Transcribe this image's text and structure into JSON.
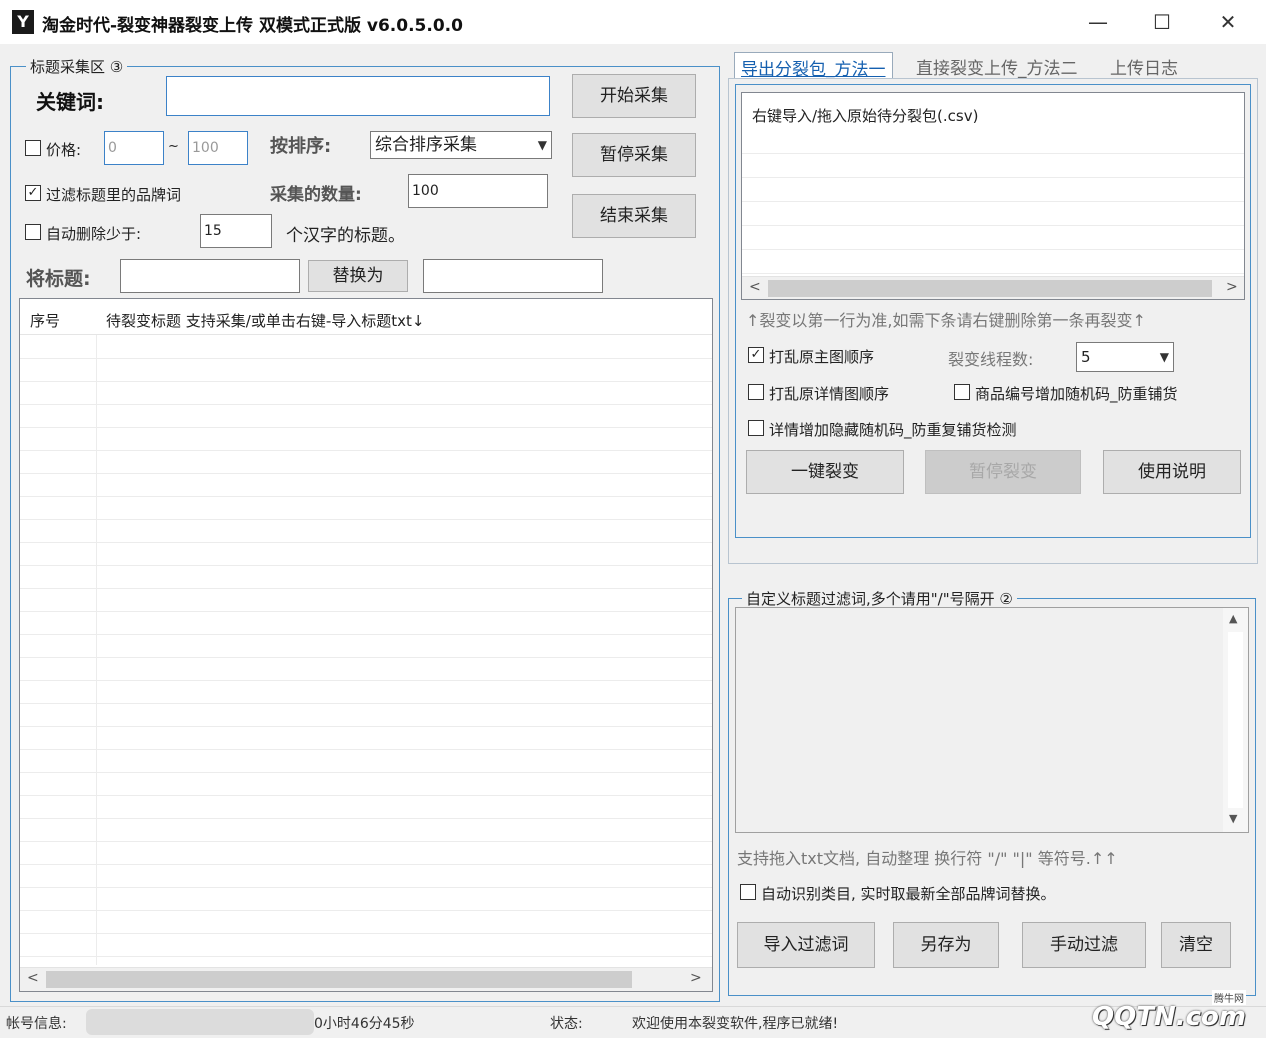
{
  "window": {
    "title": "淘金时代-裂变神器裂变上传 双模式正式版 v6.0.5.0.0",
    "minimize": "—",
    "maximize": "☐",
    "close": "✕"
  },
  "collect": {
    "group_title": "标题采集区 ③",
    "keyword_label": "关键词:",
    "keyword_value": "",
    "start_button": "开始采集",
    "pause_button": "暂停采集",
    "end_button": "结束采集",
    "price_label": "价格:",
    "price_checked": false,
    "price_min": "0",
    "price_max": "100",
    "price_sep": "~",
    "sort_label": "按排序:",
    "sort_value": "综合排序采集",
    "filter_brand_label": "过滤标题里的品牌词",
    "filter_brand_checked": true,
    "count_label": "采集的数量:",
    "count_value": "100",
    "auto_delete_label": "自动删除少于:",
    "auto_delete_checked": false,
    "auto_delete_value": "15",
    "auto_delete_suffix": "个汉字的标题。",
    "replace_label": "将标题:",
    "replace_button": "替换为",
    "replace_from": "",
    "replace_to": ""
  },
  "title_table": {
    "col_index": "序号",
    "col_title": "待裂变标题  支持采集/或单击右键-导入标题txt↓",
    "scroll_left": "<",
    "scroll_right": ">"
  },
  "tabs": [
    {
      "label": "导出分裂包_方法一"
    },
    {
      "label": "直接裂变上传_方法二"
    },
    {
      "label": "上传日志"
    }
  ],
  "split": {
    "list_header": "右键导入/拖入原始待分裂包(.csv)",
    "hint": "↑裂变以第一行为准,如需下条请右键删除第一条再裂变↑",
    "shuffle_main_label": "打乱原主图顺序",
    "shuffle_main_checked": true,
    "threads_label": "裂变线程数:",
    "threads_value": "5",
    "shuffle_detail_label": "打乱原详情图顺序",
    "shuffle_detail_checked": false,
    "product_code_label": "商品编号增加随机码_防重铺货",
    "product_code_checked": false,
    "hidden_code_label": "详情增加隐藏随机码_防重复铺货检测",
    "hidden_code_checked": false,
    "one_click_button": "一键裂变",
    "pause_button": "暂停裂变",
    "help_button": "使用说明",
    "scroll_left": "<",
    "scroll_right": ">"
  },
  "filter": {
    "group_title": "自定义标题过滤词,多个请用\"/\"号隔开 ②",
    "text": "",
    "hint": "支持拖入txt文档, 自动整理 换行符 \"/\"  \"|\"  等符号.↑↑",
    "auto_detect_label": "自动识别类目, 实时取最新全部品牌词替换。",
    "auto_detect_checked": false,
    "import_button": "导入过滤词",
    "save_as_button": "另存为",
    "manual_button": "手动过滤",
    "clear_button": "清空"
  },
  "status": {
    "account_label": "帐号信息:",
    "time_text": "0小时46分45秒",
    "state_label": "状态:",
    "state_text": "欢迎使用本裂变软件,程序已就绪!"
  },
  "watermark": {
    "text": "QQTN.com",
    "sub": "腾牛网"
  }
}
